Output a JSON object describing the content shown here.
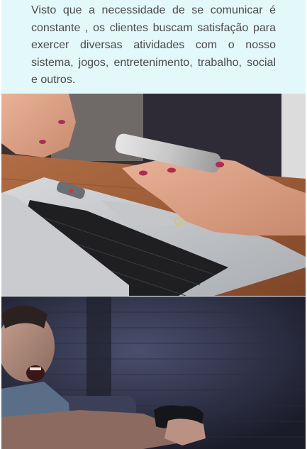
{
  "content": {
    "intro_text": "Visto que a necessidade de se comunicar é constante , os clientes buscam satisfação para exercer diversas atividades com o nosso sistema, jogos, entretenimento, trabalho, social e outros."
  },
  "images": {
    "laptop_photo": "photo-laptop-smartphone",
    "gamer_photo": "photo-man-playing-videogame"
  },
  "colors": {
    "card_background": "#e3f8fb",
    "text": "#4a4a4a"
  }
}
